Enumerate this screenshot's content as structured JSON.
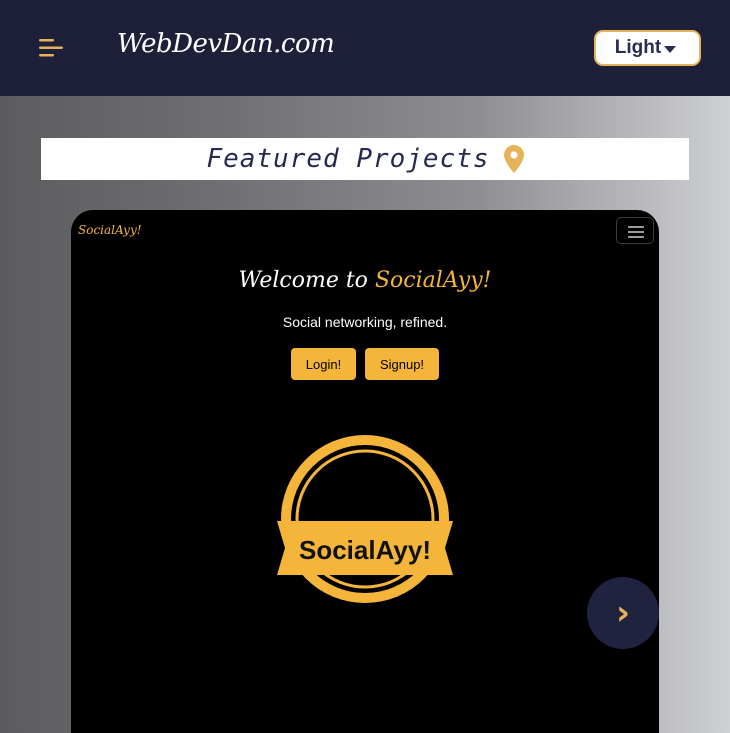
{
  "navbar": {
    "brand": "WebDevDan.com",
    "menu_icon": "hamburger-menu-icon",
    "theme_button_label": "Light",
    "theme_caret_icon": "caret-down-icon"
  },
  "featured": {
    "title": "Featured Projects",
    "icon": "map-pin-icon"
  },
  "project_preview": {
    "brand": "SocialAyy!",
    "toggler_icon": "hamburger-menu-icon",
    "welcome_prefix": "Welcome to ",
    "welcome_accent": "SocialAyy!",
    "tagline": "Social networking, refined.",
    "login_label": "Login!",
    "signup_label": "Signup!",
    "logo_text": "SocialAyy!"
  },
  "carousel": {
    "next_label": "›"
  },
  "colors": {
    "navbar_bg": "#1d2038",
    "accent_gold": "#e6b35a",
    "project_gold": "#f5b53a",
    "title_navy": "#262a4e"
  }
}
